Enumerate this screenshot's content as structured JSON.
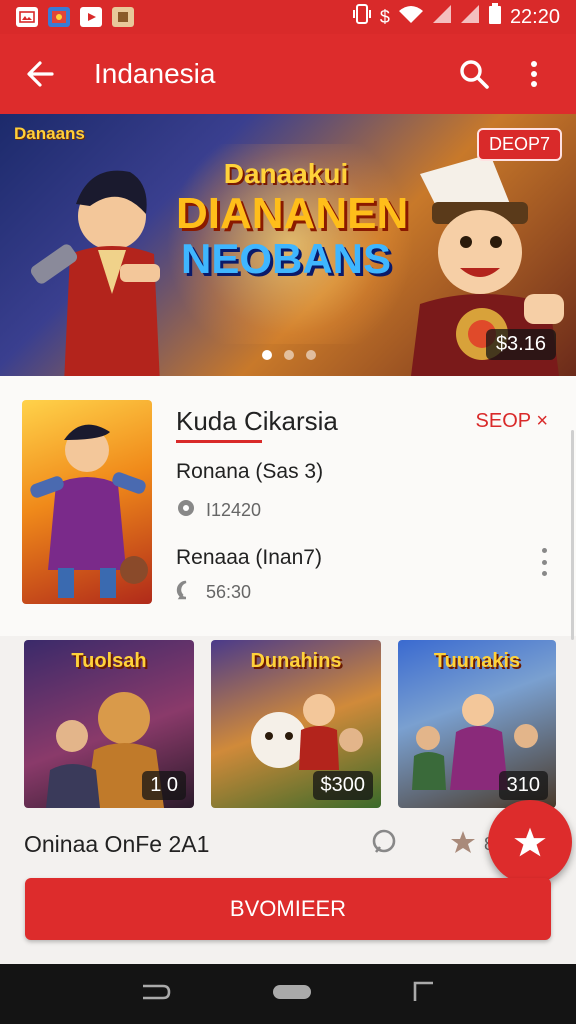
{
  "status_bar": {
    "time": "22:20",
    "notification_icons": [
      "image-notification-icon",
      "game-notification-icon",
      "youtube-notification-icon",
      "app-notification-icon"
    ],
    "colors": {
      "background": "#d92a2a"
    }
  },
  "app_bar": {
    "title": "Indanesia",
    "background": "#dd2c2c",
    "icons": [
      "back-arrow-icon",
      "search-icon",
      "more-vert-icon"
    ]
  },
  "hero": {
    "logo_text": "Danaans",
    "title_line1": "Danaakui",
    "title_line2": "DIANANEN",
    "title_line3": "NEOBANS",
    "badge": "DEOP7",
    "price": "$3.16",
    "dots": 3,
    "active_dot": 0
  },
  "featured": {
    "title": "Kuda Cikarsia",
    "tag": "SEOP ×",
    "row1_label": "Ronana (Sas 3)",
    "row1_meta": "I12420",
    "row2_label": "Renaaa (Inan7)",
    "row2_meta": "56:30"
  },
  "thumbnails": [
    {
      "title": "Tuolsah",
      "price": "1 0"
    },
    {
      "title": "Dunahins",
      "price": "$300"
    },
    {
      "title": "Tuunakis",
      "price": "310"
    }
  ],
  "bottom_row": {
    "title": "Oninaa OnFe 2A1",
    "rating": "818"
  },
  "cta": {
    "label": "BVOMIEER"
  },
  "colors": {
    "accent": "#dd2c2c",
    "page_background": "#f3f1ef",
    "nav_bar": "#141414"
  }
}
